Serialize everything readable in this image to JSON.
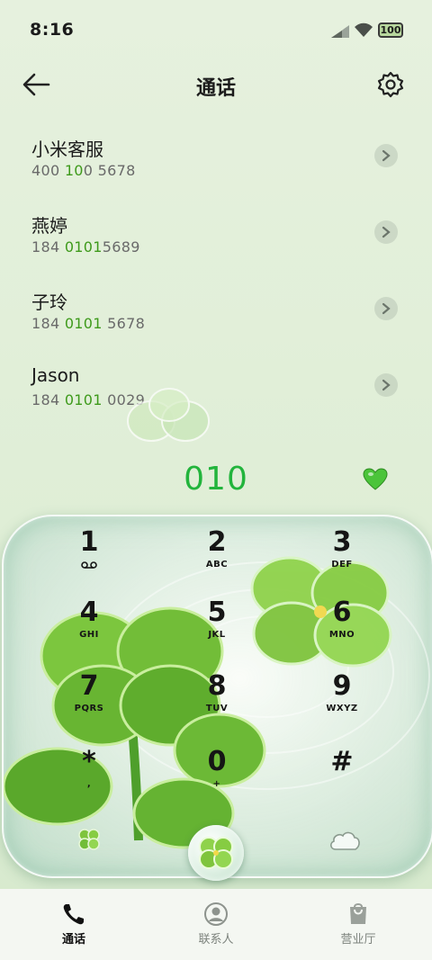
{
  "status_bar": {
    "time": "8:16",
    "battery": "100"
  },
  "header": {
    "title": "通话"
  },
  "contacts": [
    {
      "name": "小米客服",
      "number_parts": [
        "400 ",
        "10",
        "0 5678"
      ]
    },
    {
      "name": "燕婷",
      "number_parts": [
        "184 ",
        "0101",
        "5689"
      ]
    },
    {
      "name": "子玲",
      "number_parts": [
        "184 ",
        "0101",
        " 5678"
      ]
    },
    {
      "name": "Jason",
      "number_parts": [
        "184 ",
        "0101",
        " 0029"
      ]
    }
  ],
  "dialed_number": "010",
  "keypad": [
    {
      "digit": "1",
      "letters": ""
    },
    {
      "digit": "2",
      "letters": "ABC"
    },
    {
      "digit": "3",
      "letters": "DEF"
    },
    {
      "digit": "4",
      "letters": "GHI"
    },
    {
      "digit": "5",
      "letters": "JKL"
    },
    {
      "digit": "6",
      "letters": "MNO"
    },
    {
      "digit": "7",
      "letters": "PQRS"
    },
    {
      "digit": "8",
      "letters": "TUV"
    },
    {
      "digit": "9",
      "letters": "WXYZ"
    },
    {
      "digit": "*",
      "letters": ","
    },
    {
      "digit": "0",
      "letters": "+"
    },
    {
      "digit": "#",
      "letters": ""
    }
  ],
  "tabs": [
    {
      "label": "通话",
      "icon": "phone-icon",
      "active": true
    },
    {
      "label": "联系人",
      "icon": "contact-icon",
      "active": false
    },
    {
      "label": "营业厅",
      "icon": "bag-icon",
      "active": false
    }
  ],
  "colors": {
    "accent_green": "#22b43c",
    "highlight_green": "#3e9a1b"
  }
}
